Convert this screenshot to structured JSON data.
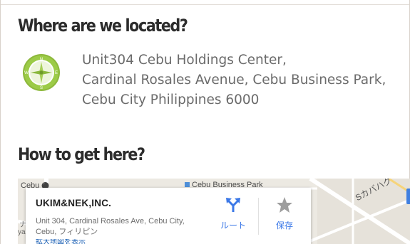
{
  "location_section": {
    "heading": "Where are we located?",
    "address_lines": [
      "Unit304 Cebu Holdings Center,",
      "Cardinal Rosales Avenue, Cebu Business Park,",
      "Cebu City Philippines 6000"
    ],
    "compass_letters": {
      "n": "N",
      "s": "S",
      "e": "E",
      "w": "W"
    }
  },
  "directions_section": {
    "heading": "How to get here?"
  },
  "map": {
    "labels": {
      "cebu": "Cebu",
      "business_park": "Cebu Business Park",
      "district": "Sカバハグ"
    },
    "fragments": [
      "ナ",
      "ya"
    ],
    "info_card": {
      "title": "UKIM&NEK,INC.",
      "address": "Unit 304, Cardinal Rosales Ave, Cebu City, Cebu, フィリピン",
      "sub_link": "拡大地図を表示",
      "route_label": "ルート",
      "save_label": "保存"
    }
  },
  "colors": {
    "heading": "#2c2c2c",
    "address_text": "#6b6b6b",
    "compass_green": "#8db83c",
    "map_background": "#ece9e2",
    "map_accent_blue": "#3b78e7"
  },
  "icons": {
    "compass": "compass-icon",
    "route": "route-icon",
    "save": "star-icon",
    "pin": "location-pin-icon"
  }
}
